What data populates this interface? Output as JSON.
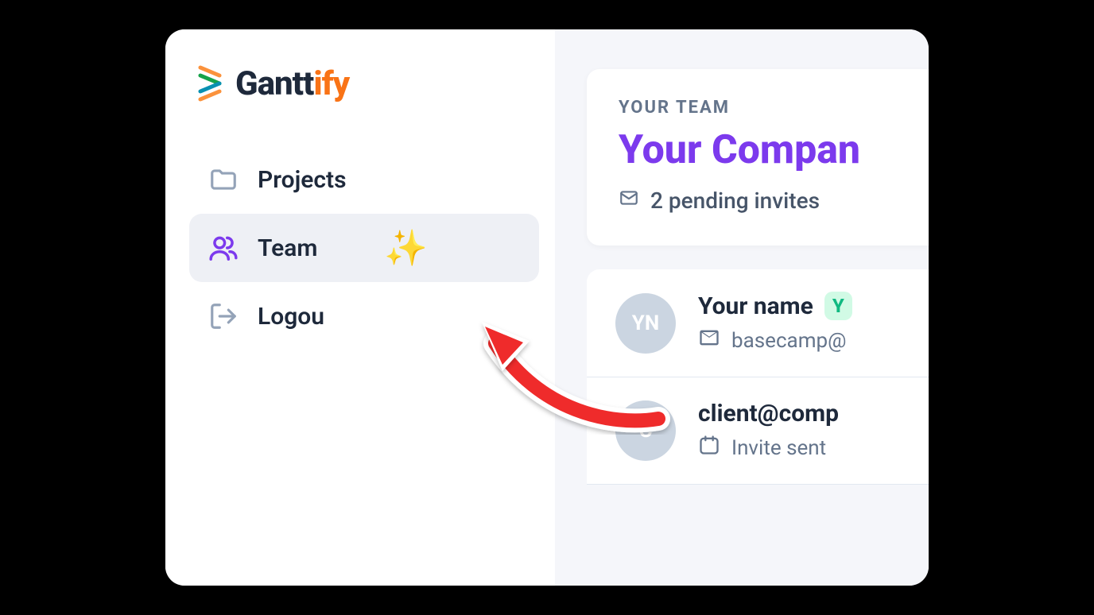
{
  "logo": {
    "text_a": "Gantt",
    "text_b": "ify"
  },
  "sidebar": {
    "items": [
      {
        "label": "Projects",
        "icon": "folder-icon",
        "active": false
      },
      {
        "label": "Team",
        "icon": "users-icon",
        "active": true,
        "sparkle": "✨"
      },
      {
        "label": "Logou",
        "icon": "logout-icon",
        "active": false
      }
    ]
  },
  "team": {
    "label": "YOUR TEAM",
    "name": "Your Compan",
    "pending": "2 pending invites"
  },
  "members": [
    {
      "initials": "YN",
      "name": "Your name",
      "badge": "Y",
      "email": "basecamp@",
      "sub_icon": "envelope-icon"
    },
    {
      "initials": "C",
      "name": "client@comp",
      "badge": "",
      "sub": "Invite sent",
      "sub_icon": "calendar-icon"
    }
  ]
}
